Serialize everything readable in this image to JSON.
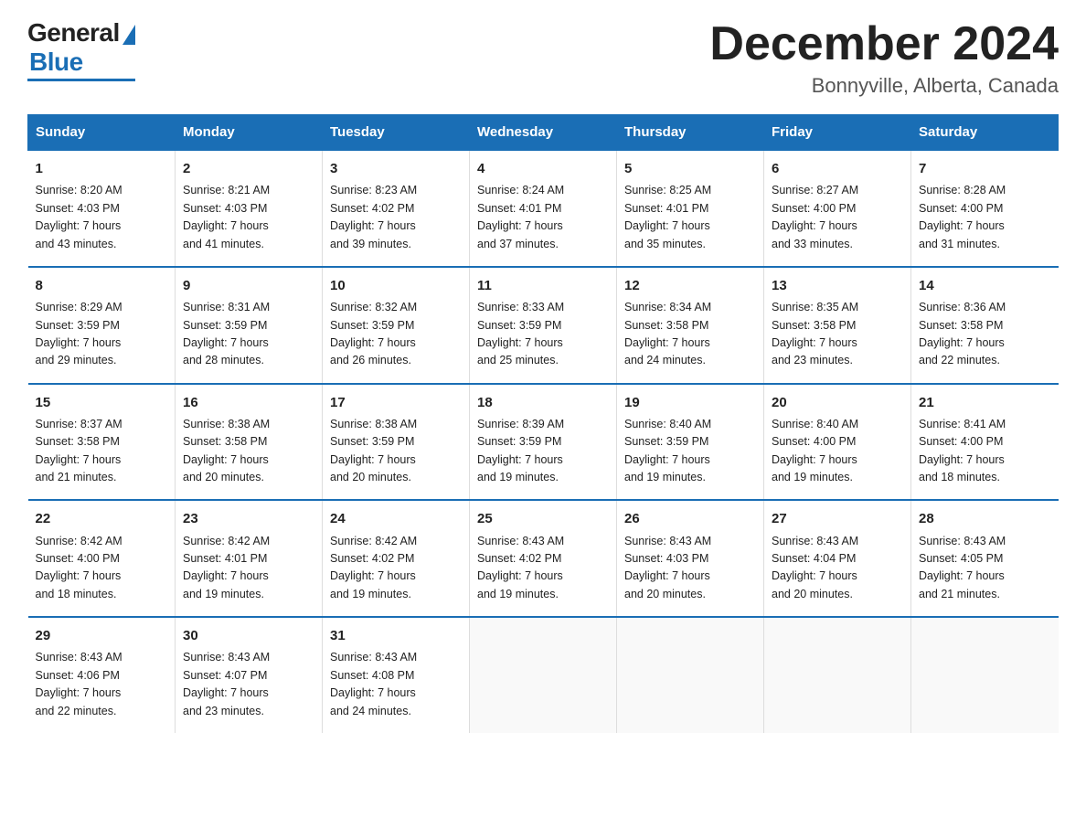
{
  "logo": {
    "general": "General",
    "blue": "Blue"
  },
  "title": "December 2024",
  "location": "Bonnyville, Alberta, Canada",
  "days_of_week": [
    "Sunday",
    "Monday",
    "Tuesday",
    "Wednesday",
    "Thursday",
    "Friday",
    "Saturday"
  ],
  "weeks": [
    [
      {
        "day": 1,
        "lines": [
          "Sunrise: 8:20 AM",
          "Sunset: 4:03 PM",
          "Daylight: 7 hours",
          "and 43 minutes."
        ]
      },
      {
        "day": 2,
        "lines": [
          "Sunrise: 8:21 AM",
          "Sunset: 4:03 PM",
          "Daylight: 7 hours",
          "and 41 minutes."
        ]
      },
      {
        "day": 3,
        "lines": [
          "Sunrise: 8:23 AM",
          "Sunset: 4:02 PM",
          "Daylight: 7 hours",
          "and 39 minutes."
        ]
      },
      {
        "day": 4,
        "lines": [
          "Sunrise: 8:24 AM",
          "Sunset: 4:01 PM",
          "Daylight: 7 hours",
          "and 37 minutes."
        ]
      },
      {
        "day": 5,
        "lines": [
          "Sunrise: 8:25 AM",
          "Sunset: 4:01 PM",
          "Daylight: 7 hours",
          "and 35 minutes."
        ]
      },
      {
        "day": 6,
        "lines": [
          "Sunrise: 8:27 AM",
          "Sunset: 4:00 PM",
          "Daylight: 7 hours",
          "and 33 minutes."
        ]
      },
      {
        "day": 7,
        "lines": [
          "Sunrise: 8:28 AM",
          "Sunset: 4:00 PM",
          "Daylight: 7 hours",
          "and 31 minutes."
        ]
      }
    ],
    [
      {
        "day": 8,
        "lines": [
          "Sunrise: 8:29 AM",
          "Sunset: 3:59 PM",
          "Daylight: 7 hours",
          "and 29 minutes."
        ]
      },
      {
        "day": 9,
        "lines": [
          "Sunrise: 8:31 AM",
          "Sunset: 3:59 PM",
          "Daylight: 7 hours",
          "and 28 minutes."
        ]
      },
      {
        "day": 10,
        "lines": [
          "Sunrise: 8:32 AM",
          "Sunset: 3:59 PM",
          "Daylight: 7 hours",
          "and 26 minutes."
        ]
      },
      {
        "day": 11,
        "lines": [
          "Sunrise: 8:33 AM",
          "Sunset: 3:59 PM",
          "Daylight: 7 hours",
          "and 25 minutes."
        ]
      },
      {
        "day": 12,
        "lines": [
          "Sunrise: 8:34 AM",
          "Sunset: 3:58 PM",
          "Daylight: 7 hours",
          "and 24 minutes."
        ]
      },
      {
        "day": 13,
        "lines": [
          "Sunrise: 8:35 AM",
          "Sunset: 3:58 PM",
          "Daylight: 7 hours",
          "and 23 minutes."
        ]
      },
      {
        "day": 14,
        "lines": [
          "Sunrise: 8:36 AM",
          "Sunset: 3:58 PM",
          "Daylight: 7 hours",
          "and 22 minutes."
        ]
      }
    ],
    [
      {
        "day": 15,
        "lines": [
          "Sunrise: 8:37 AM",
          "Sunset: 3:58 PM",
          "Daylight: 7 hours",
          "and 21 minutes."
        ]
      },
      {
        "day": 16,
        "lines": [
          "Sunrise: 8:38 AM",
          "Sunset: 3:58 PM",
          "Daylight: 7 hours",
          "and 20 minutes."
        ]
      },
      {
        "day": 17,
        "lines": [
          "Sunrise: 8:38 AM",
          "Sunset: 3:59 PM",
          "Daylight: 7 hours",
          "and 20 minutes."
        ]
      },
      {
        "day": 18,
        "lines": [
          "Sunrise: 8:39 AM",
          "Sunset: 3:59 PM",
          "Daylight: 7 hours",
          "and 19 minutes."
        ]
      },
      {
        "day": 19,
        "lines": [
          "Sunrise: 8:40 AM",
          "Sunset: 3:59 PM",
          "Daylight: 7 hours",
          "and 19 minutes."
        ]
      },
      {
        "day": 20,
        "lines": [
          "Sunrise: 8:40 AM",
          "Sunset: 4:00 PM",
          "Daylight: 7 hours",
          "and 19 minutes."
        ]
      },
      {
        "day": 21,
        "lines": [
          "Sunrise: 8:41 AM",
          "Sunset: 4:00 PM",
          "Daylight: 7 hours",
          "and 18 minutes."
        ]
      }
    ],
    [
      {
        "day": 22,
        "lines": [
          "Sunrise: 8:42 AM",
          "Sunset: 4:00 PM",
          "Daylight: 7 hours",
          "and 18 minutes."
        ]
      },
      {
        "day": 23,
        "lines": [
          "Sunrise: 8:42 AM",
          "Sunset: 4:01 PM",
          "Daylight: 7 hours",
          "and 19 minutes."
        ]
      },
      {
        "day": 24,
        "lines": [
          "Sunrise: 8:42 AM",
          "Sunset: 4:02 PM",
          "Daylight: 7 hours",
          "and 19 minutes."
        ]
      },
      {
        "day": 25,
        "lines": [
          "Sunrise: 8:43 AM",
          "Sunset: 4:02 PM",
          "Daylight: 7 hours",
          "and 19 minutes."
        ]
      },
      {
        "day": 26,
        "lines": [
          "Sunrise: 8:43 AM",
          "Sunset: 4:03 PM",
          "Daylight: 7 hours",
          "and 20 minutes."
        ]
      },
      {
        "day": 27,
        "lines": [
          "Sunrise: 8:43 AM",
          "Sunset: 4:04 PM",
          "Daylight: 7 hours",
          "and 20 minutes."
        ]
      },
      {
        "day": 28,
        "lines": [
          "Sunrise: 8:43 AM",
          "Sunset: 4:05 PM",
          "Daylight: 7 hours",
          "and 21 minutes."
        ]
      }
    ],
    [
      {
        "day": 29,
        "lines": [
          "Sunrise: 8:43 AM",
          "Sunset: 4:06 PM",
          "Daylight: 7 hours",
          "and 22 minutes."
        ]
      },
      {
        "day": 30,
        "lines": [
          "Sunrise: 8:43 AM",
          "Sunset: 4:07 PM",
          "Daylight: 7 hours",
          "and 23 minutes."
        ]
      },
      {
        "day": 31,
        "lines": [
          "Sunrise: 8:43 AM",
          "Sunset: 4:08 PM",
          "Daylight: 7 hours",
          "and 24 minutes."
        ]
      },
      null,
      null,
      null,
      null
    ]
  ]
}
